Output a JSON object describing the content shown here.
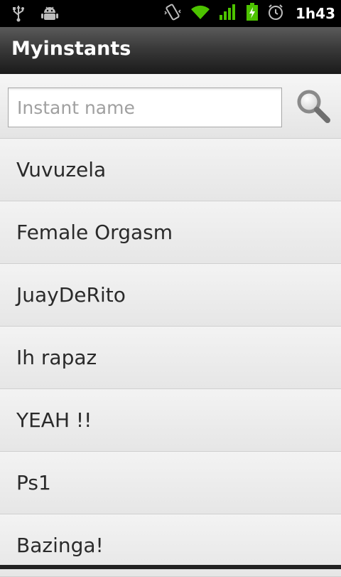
{
  "status_bar": {
    "time": "1h43",
    "left_icons": [
      "usb-icon",
      "android-debug-icon"
    ],
    "right_icons": [
      "vibrate-icon",
      "wifi-icon",
      "signal-icon",
      "battery-charging-icon",
      "alarm-icon"
    ],
    "colors": {
      "wifi": "#4dc300",
      "signal": "#4dc300",
      "battery": "#4dc300"
    }
  },
  "app": {
    "title": "Myinstants"
  },
  "search": {
    "placeholder": "Instant name",
    "value": "",
    "icon": "search-icon"
  },
  "list": {
    "items": [
      {
        "label": "Vuvuzela"
      },
      {
        "label": "Female Orgasm"
      },
      {
        "label": "JuayDeRito"
      },
      {
        "label": "Ih rapaz"
      },
      {
        "label": "YEAH !!"
      },
      {
        "label": "Ps1"
      },
      {
        "label": "Bazinga!"
      }
    ]
  }
}
